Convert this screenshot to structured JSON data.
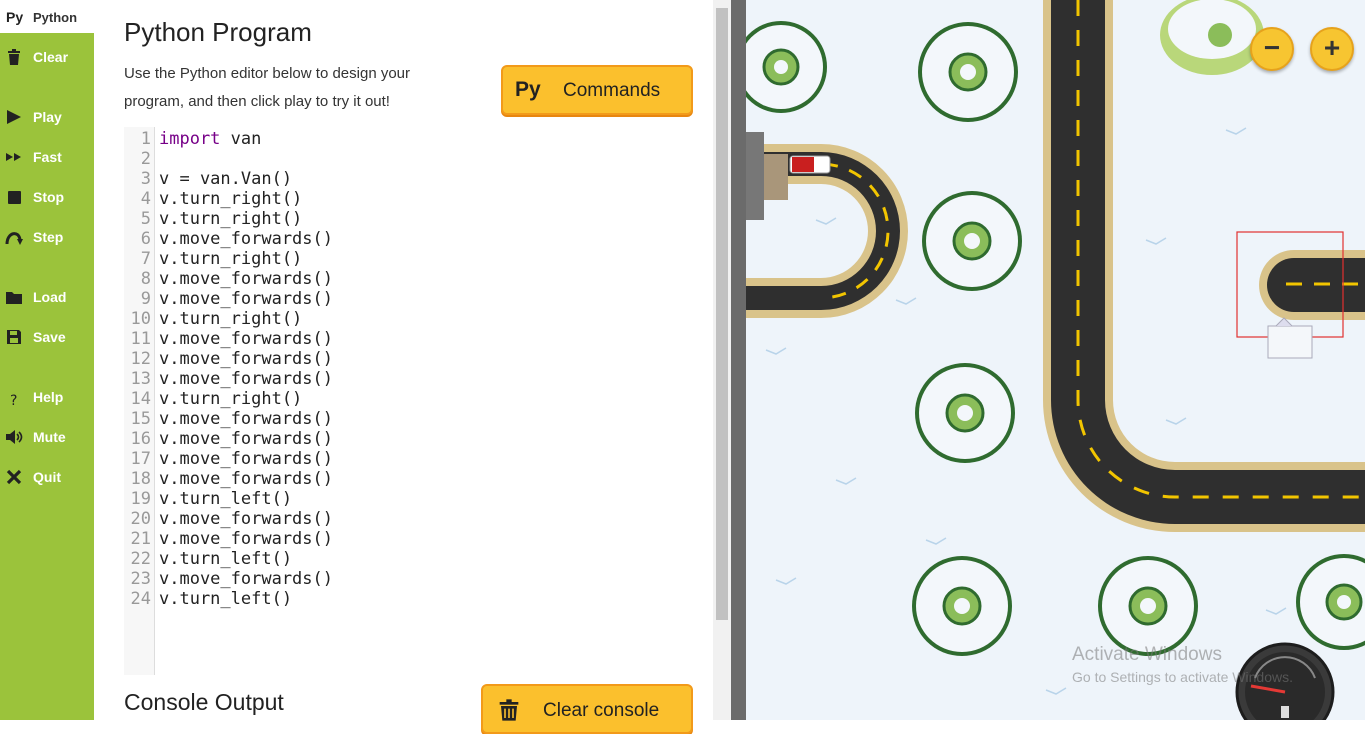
{
  "sidebar": {
    "tab": {
      "icon_text": "Py",
      "label": "Python"
    },
    "items": [
      {
        "label": "Clear",
        "icon": "trash-icon"
      },
      {
        "label": "Play",
        "icon": "play-icon"
      },
      {
        "label": "Fast",
        "icon": "fast-forward-icon"
      },
      {
        "label": "Stop",
        "icon": "stop-icon"
      },
      {
        "label": "Step",
        "icon": "step-icon"
      },
      {
        "label": "Load",
        "icon": "folder-icon"
      },
      {
        "label": "Save",
        "icon": "save-icon"
      },
      {
        "label": "Help",
        "icon": "help-icon"
      },
      {
        "label": "Mute",
        "icon": "speaker-icon"
      },
      {
        "label": "Quit",
        "icon": "close-icon"
      }
    ]
  },
  "editor": {
    "title": "Python Program",
    "description": "Use the Python editor below to design your program, and then click play to try it out!",
    "commands_button": {
      "icon_text": "Py",
      "label": "Commands"
    },
    "lines": [
      {
        "n": "1",
        "kw": "import",
        "text": " van"
      },
      {
        "n": "2",
        "kw": "",
        "text": ""
      },
      {
        "n": "3",
        "kw": "",
        "text": "v = van.Van()"
      },
      {
        "n": "4",
        "kw": "",
        "text": "v.turn_right()"
      },
      {
        "n": "5",
        "kw": "",
        "text": "v.turn_right()"
      },
      {
        "n": "6",
        "kw": "",
        "text": "v.move_forwards()"
      },
      {
        "n": "7",
        "kw": "",
        "text": "v.turn_right()"
      },
      {
        "n": "8",
        "kw": "",
        "text": "v.move_forwards()"
      },
      {
        "n": "9",
        "kw": "",
        "text": "v.move_forwards()"
      },
      {
        "n": "10",
        "kw": "",
        "text": "v.turn_right()"
      },
      {
        "n": "11",
        "kw": "",
        "text": "v.move_forwards()"
      },
      {
        "n": "12",
        "kw": "",
        "text": "v.move_forwards()"
      },
      {
        "n": "13",
        "kw": "",
        "text": "v.move_forwards()"
      },
      {
        "n": "14",
        "kw": "",
        "text": "v.turn_right()"
      },
      {
        "n": "15",
        "kw": "",
        "text": "v.move_forwards()"
      },
      {
        "n": "16",
        "kw": "",
        "text": "v.move_forwards()"
      },
      {
        "n": "17",
        "kw": "",
        "text": "v.move_forwards()"
      },
      {
        "n": "18",
        "kw": "",
        "text": "v.move_forwards()"
      },
      {
        "n": "19",
        "kw": "",
        "text": "v.turn_left()"
      },
      {
        "n": "20",
        "kw": "",
        "text": "v.move_forwards()"
      },
      {
        "n": "21",
        "kw": "",
        "text": "v.move_forwards()"
      },
      {
        "n": "22",
        "kw": "",
        "text": "v.turn_left()"
      },
      {
        "n": "23",
        "kw": "",
        "text": "v.move_forwards()"
      },
      {
        "n": "24",
        "kw": "",
        "text": "v.turn_left()"
      }
    ],
    "console_title": "Console Output",
    "clear_console_label": "Clear console"
  },
  "map": {
    "zoom_out_label": "−",
    "zoom_in_label": "+",
    "watermark_line1": "Activate Windows",
    "watermark_line2": "Go to Settings to activate Windows."
  },
  "colors": {
    "sidebar": "#9bc33b",
    "button": "#fbc02d",
    "road": "#2f2f2f",
    "road_edge": "#d9c38a",
    "snow": "#eef4fa"
  }
}
